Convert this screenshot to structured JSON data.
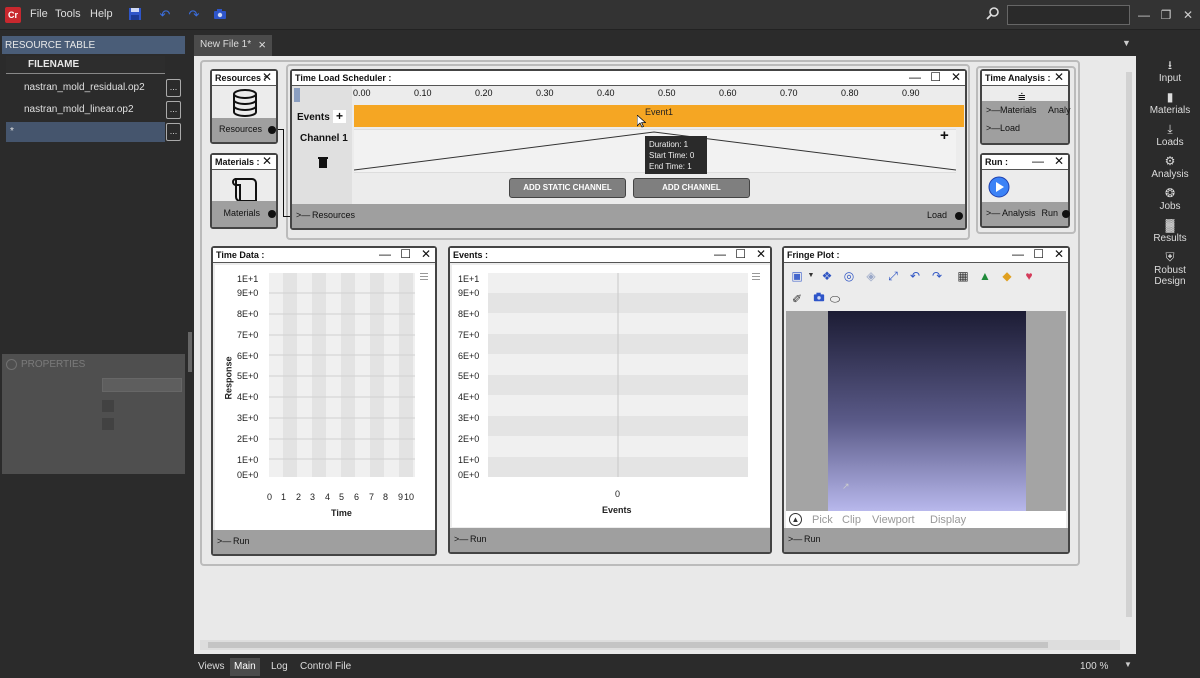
{
  "app": {
    "logo": "Cr"
  },
  "menu": [
    "File",
    "Tools",
    "Help"
  ],
  "document_tab": {
    "title": "New File 1*"
  },
  "resource_table": {
    "header": "RESOURCE TABLE",
    "column": "FILENAME",
    "rows": [
      "nastran_mold_residual.op2",
      "nastran_mold_linear.op2",
      "*"
    ],
    "row_button": "..."
  },
  "properties": {
    "header": "PROPERTIES"
  },
  "nodes": {
    "resources": {
      "title": "Resources :",
      "out_pin": "Resources"
    },
    "materials": {
      "title": "Materials :",
      "out_pin": "Materials"
    },
    "scheduler": {
      "title": "Time Load Scheduler :",
      "ruler": [
        "0.00",
        "0.10",
        "0.20",
        "0.30",
        "0.40",
        "0.50",
        "0.60",
        "0.70",
        "0.80",
        "0.90"
      ],
      "events_label": "Events",
      "channel_label": "Channel 1",
      "event_name": "Event1",
      "tooltip": [
        "Duration: 1",
        "Start Time: 0",
        "End Time: 1"
      ],
      "add_static": "ADD STATIC CHANNEL",
      "add_channel": "ADD CHANNEL",
      "in_pin": "Resources",
      "out_pin": "Load"
    },
    "time_analysis": {
      "title": "Time Analysis :",
      "in1": "Materials",
      "in2": "Load",
      "out": "Analy"
    },
    "run": {
      "title": "Run :",
      "in": "Analysis",
      "out": "Run"
    },
    "time_data": {
      "title": "Time Data :",
      "in_pin": "Run",
      "ylabel": "Response",
      "xlabel": "Time",
      "yticks": [
        "1E+1",
        "9E+0",
        "8E+0",
        "7E+0",
        "6E+0",
        "5E+0",
        "4E+0",
        "3E+0",
        "2E+0",
        "1E+0",
        "0E+0"
      ],
      "xticks": [
        "0",
        "1",
        "2",
        "3",
        "4",
        "5",
        "6",
        "7",
        "8",
        "9",
        "10"
      ]
    },
    "events": {
      "title": "Events :",
      "in_pin": "Run",
      "xlabel": "Events",
      "yticks": [
        "1E+1",
        "9E+0",
        "8E+0",
        "7E+0",
        "6E+0",
        "5E+0",
        "4E+0",
        "3E+0",
        "2E+0",
        "1E+0",
        "0E+0"
      ],
      "xticks": [
        "0"
      ]
    },
    "fringe": {
      "title": "Fringe Plot :",
      "in_pin": "Run",
      "links": [
        "Pick",
        "Clip",
        "Viewport",
        "Display"
      ]
    }
  },
  "right_bar": [
    "Input",
    "Materials",
    "Loads",
    "Analysis",
    "Jobs",
    "Results",
    "Robust Design"
  ],
  "bottom_tabs": [
    "Views",
    "Main",
    "Log",
    "Control File"
  ],
  "zoom": "100 %",
  "colors": {
    "accent": "#f5a623",
    "header": "#4a5d78",
    "play": "#3b82f6"
  }
}
